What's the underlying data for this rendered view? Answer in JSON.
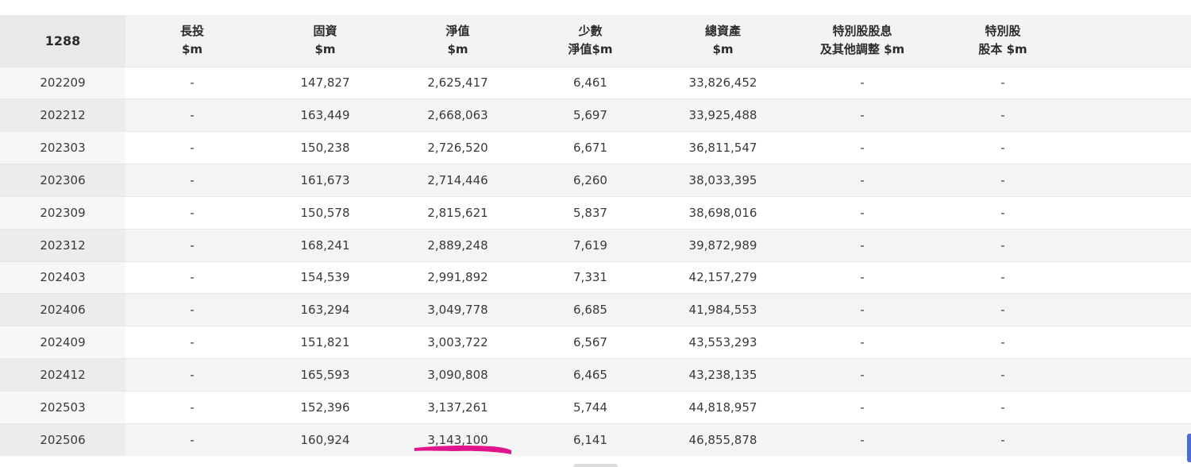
{
  "table": {
    "headers": [
      {
        "line1": "1288",
        "line2": ""
      },
      {
        "line1": "長投",
        "line2": "$m"
      },
      {
        "line1": "固資",
        "line2": "$m"
      },
      {
        "line1": "淨值",
        "line2": "$m"
      },
      {
        "line1": "少數",
        "line2": "淨值$m"
      },
      {
        "line1": "總資產",
        "line2": "$m"
      },
      {
        "line1": "特別股股息",
        "line2": "及其他調整 $m"
      },
      {
        "line1": "特別股",
        "line2": "股本 $m"
      },
      {
        "line1": "",
        "line2": ""
      }
    ],
    "rows": [
      {
        "period": "202209",
        "long_inv": "-",
        "fixed_assets": "147,827",
        "net_value": "2,625,417",
        "minority": "6,461",
        "total_assets": "33,826,452",
        "pref_div": "-",
        "pref_capital": "-"
      },
      {
        "period": "202212",
        "long_inv": "-",
        "fixed_assets": "163,449",
        "net_value": "2,668,063",
        "minority": "5,697",
        "total_assets": "33,925,488",
        "pref_div": "-",
        "pref_capital": "-"
      },
      {
        "period": "202303",
        "long_inv": "-",
        "fixed_assets": "150,238",
        "net_value": "2,726,520",
        "minority": "6,671",
        "total_assets": "36,811,547",
        "pref_div": "-",
        "pref_capital": "-"
      },
      {
        "period": "202306",
        "long_inv": "-",
        "fixed_assets": "161,673",
        "net_value": "2,714,446",
        "minority": "6,260",
        "total_assets": "38,033,395",
        "pref_div": "-",
        "pref_capital": "-"
      },
      {
        "period": "202309",
        "long_inv": "-",
        "fixed_assets": "150,578",
        "net_value": "2,815,621",
        "minority": "5,837",
        "total_assets": "38,698,016",
        "pref_div": "-",
        "pref_capital": "-"
      },
      {
        "period": "202312",
        "long_inv": "-",
        "fixed_assets": "168,241",
        "net_value": "2,889,248",
        "minority": "7,619",
        "total_assets": "39,872,989",
        "pref_div": "-",
        "pref_capital": "-"
      },
      {
        "period": "202403",
        "long_inv": "-",
        "fixed_assets": "154,539",
        "net_value": "2,991,892",
        "minority": "7,331",
        "total_assets": "42,157,279",
        "pref_div": "-",
        "pref_capital": "-"
      },
      {
        "period": "202406",
        "long_inv": "-",
        "fixed_assets": "163,294",
        "net_value": "3,049,778",
        "minority": "6,685",
        "total_assets": "41,984,553",
        "pref_div": "-",
        "pref_capital": "-"
      },
      {
        "period": "202409",
        "long_inv": "-",
        "fixed_assets": "151,821",
        "net_value": "3,003,722",
        "minority": "6,567",
        "total_assets": "43,553,293",
        "pref_div": "-",
        "pref_capital": "-"
      },
      {
        "period": "202412",
        "long_inv": "-",
        "fixed_assets": "165,593",
        "net_value": "3,090,808",
        "minority": "6,465",
        "total_assets": "43,238,135",
        "pref_div": "-",
        "pref_capital": "-"
      },
      {
        "period": "202503",
        "long_inv": "-",
        "fixed_assets": "152,396",
        "net_value": "3,137,261",
        "minority": "5,744",
        "total_assets": "44,818,957",
        "pref_div": "-",
        "pref_capital": "-"
      },
      {
        "period": "202506",
        "long_inv": "-",
        "fixed_assets": "160,924",
        "net_value": "3,143,100",
        "minority": "6,141",
        "total_assets": "46,855,878",
        "pref_div": "-",
        "pref_capital": "-"
      }
    ]
  },
  "annotation": {
    "color": "#e0148c"
  },
  "colors": {
    "header_bg": "#f3f3f3",
    "stripe_bg": "#f4f4f4",
    "side_widget": "#4a6fd1"
  }
}
